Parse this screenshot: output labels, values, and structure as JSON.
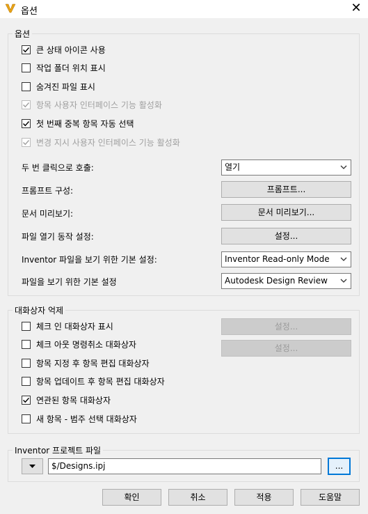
{
  "window": {
    "title": "옵션"
  },
  "options_group": {
    "title": "옵션",
    "checkboxes": [
      {
        "label": "큰 상태 아이콘 사용",
        "checked": true,
        "enabled": true
      },
      {
        "label": "작업 폴더 위치 표시",
        "checked": false,
        "enabled": true
      },
      {
        "label": "숨겨진 파일 표시",
        "checked": false,
        "enabled": true
      },
      {
        "label": "항목 사용자 인터페이스 기능 활성화",
        "checked": true,
        "enabled": false
      },
      {
        "label": "첫 번째 중복 항목 자동 선택",
        "checked": true,
        "enabled": true
      },
      {
        "label": "변경 지시 사용자 인터페이스 기능 활성화",
        "checked": true,
        "enabled": false
      }
    ],
    "double_click_label": "두 번 클릭으로 호출:",
    "double_click_value": "열기",
    "prompt_config_label": "프롬프트 구성:",
    "prompt_button": "프롬프트...",
    "doc_preview_label": "문서 미리보기:",
    "doc_preview_button": "문서 미리보기...",
    "file_open_label": "파일 열기 동작 설정:",
    "file_open_button": "설정...",
    "inventor_view_label": "Inventor 파일을 보기 위한 기본 설정:",
    "inventor_view_value": "Inventor Read-only Mode",
    "file_view_label": "파일을 보기 위한 기본 설정",
    "file_view_value": "Autodesk Design Review"
  },
  "dialog_group": {
    "title": "대화상자 억제",
    "checkboxes": [
      {
        "label": "체크 인 대화상자 표시",
        "checked": false,
        "enabled": true
      },
      {
        "label": "체크 아웃 명령취소 대화상자",
        "checked": false,
        "enabled": true
      },
      {
        "label": "항목 지정 후 항목 편집 대화상자",
        "checked": false,
        "enabled": true
      },
      {
        "label": "항목 업데이트 후 항목 편집 대화상자",
        "checked": false,
        "enabled": true
      },
      {
        "label": "연관된 항목 대화상자",
        "checked": true,
        "enabled": true
      },
      {
        "label": "새 항목 - 범주 선택 대화상자",
        "checked": false,
        "enabled": true
      }
    ],
    "settings_button_1": "설정...",
    "settings_button_2": "설정..."
  },
  "project_group": {
    "title": "Inventor 프로젝트 파일",
    "path_value": "$/Designs.ipj",
    "browse_label": "..."
  },
  "footer": {
    "ok": "확인",
    "cancel": "취소",
    "apply": "적용",
    "help": "도움말"
  }
}
